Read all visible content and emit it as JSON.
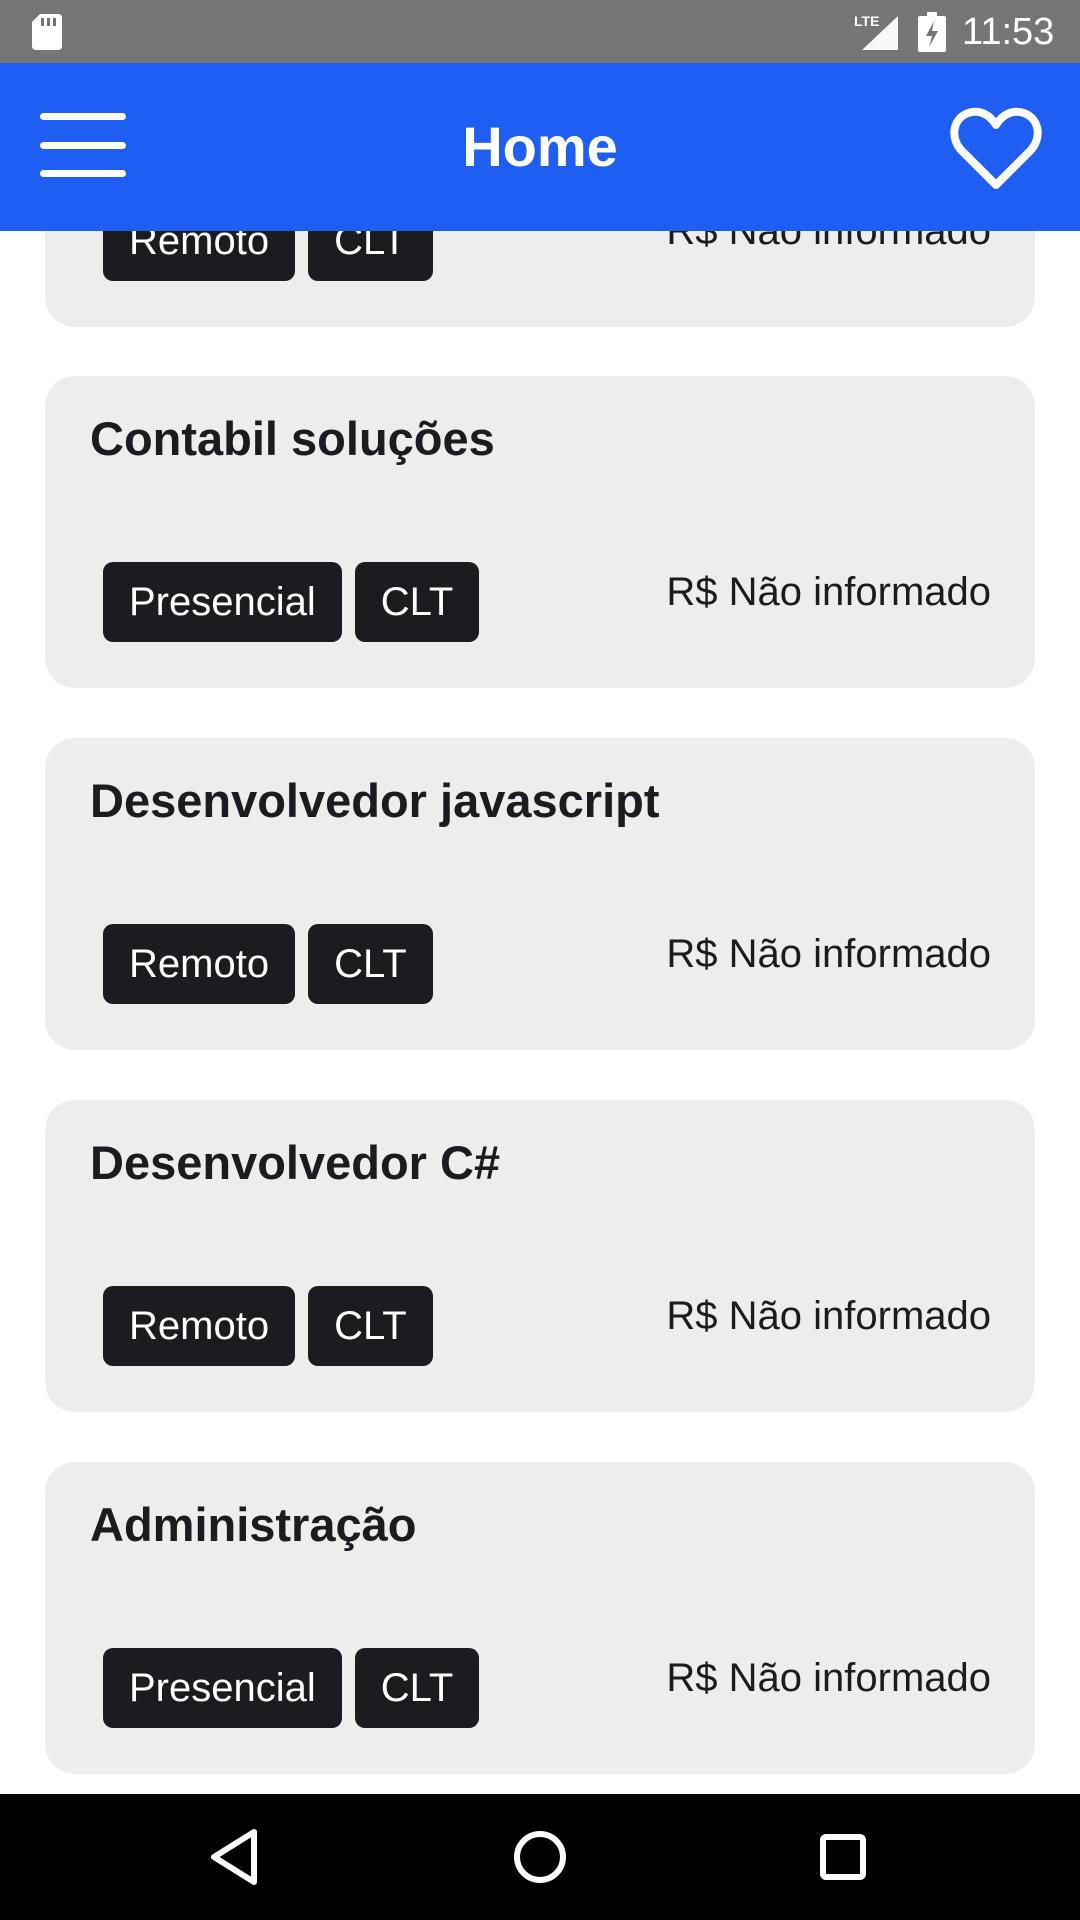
{
  "status_bar": {
    "time": "11:53",
    "network": "LTE",
    "icons": [
      "sd-card-icon",
      "lte-signal-icon",
      "battery-charging-icon"
    ]
  },
  "app_bar": {
    "title": "Home",
    "menu_icon": "menu-icon",
    "favorite_icon": "heart-outline-icon",
    "color": "#1f5ef2"
  },
  "jobs": [
    {
      "title": "",
      "tags": [
        "Remoto",
        "CLT"
      ],
      "salary": "R$ Não informado"
    },
    {
      "title": "Contabil soluções",
      "tags": [
        "Presencial",
        "CLT"
      ],
      "salary": "R$ Não informado"
    },
    {
      "title": "Desenvolvedor javascript",
      "tags": [
        "Remoto",
        "CLT"
      ],
      "salary": "R$ Não informado"
    },
    {
      "title": "Desenvolvedor C#",
      "tags": [
        "Remoto",
        "CLT"
      ],
      "salary": "R$ Não informado"
    },
    {
      "title": "Administração",
      "tags": [
        "Presencial",
        "CLT"
      ],
      "salary": "R$ Não informado"
    }
  ],
  "nav_bar": {
    "buttons": [
      "back-icon",
      "home-icon",
      "recents-icon"
    ]
  },
  "colors": {
    "card_background": "#ededed",
    "tag_background": "#1b1c20",
    "text": "#1b1c20"
  }
}
